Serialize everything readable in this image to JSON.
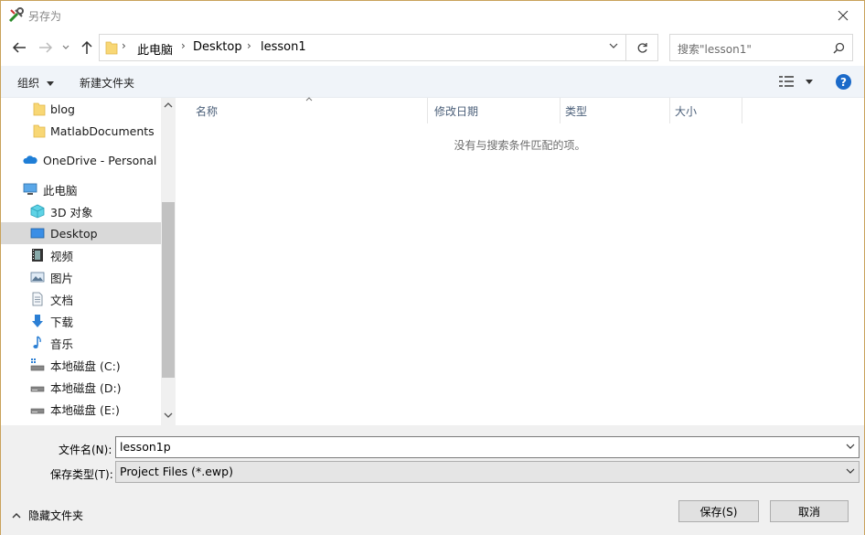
{
  "window": {
    "title": "另存为"
  },
  "nav": {
    "breadcrumb": [
      "此电脑",
      "Desktop",
      "lesson1"
    ],
    "search_placeholder": "搜索\"lesson1\""
  },
  "toolbar": {
    "organize": "组织",
    "new_folder": "新建文件夹"
  },
  "sidebar": {
    "items": [
      {
        "label": "blog"
      },
      {
        "label": "MatlabDocuments"
      },
      {
        "label": "OneDrive - Personal"
      },
      {
        "label": "此电脑"
      },
      {
        "label": "3D 对象"
      },
      {
        "label": "Desktop"
      },
      {
        "label": "视频"
      },
      {
        "label": "图片"
      },
      {
        "label": "文档"
      },
      {
        "label": "下载"
      },
      {
        "label": "音乐"
      },
      {
        "label": "本地磁盘 (C:)"
      },
      {
        "label": "本地磁盘 (D:)"
      },
      {
        "label": "本地磁盘 (E:)"
      }
    ],
    "selected": "Desktop"
  },
  "columns": {
    "name": "名称",
    "date": "修改日期",
    "type": "类型",
    "size": "大小"
  },
  "content": {
    "empty_message": "没有与搜索条件匹配的项。"
  },
  "form": {
    "filename_label": "文件名(N):",
    "filename_value": "lesson1p",
    "filetype_label": "保存类型(T):",
    "filetype_value": "Project Files (*.ewp)"
  },
  "footer": {
    "hide_folders": "隐藏文件夹",
    "save": "保存(S)",
    "cancel": "取消"
  },
  "colors": {
    "selected_bg": "#d9d9d9",
    "toolbar_bg": "#f0f4f9",
    "help_blue": "#1b6ac9",
    "column_header": "#4c607a"
  }
}
